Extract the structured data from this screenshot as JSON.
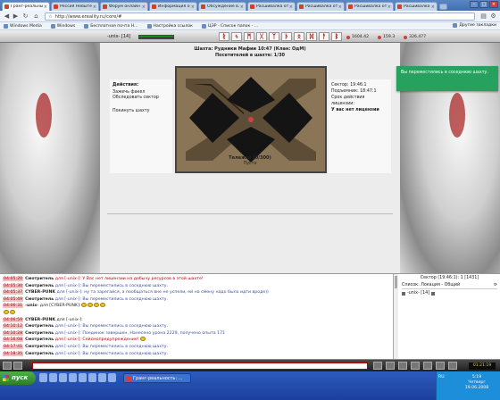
{
  "browser": {
    "tabs": [
      {
        "label": "Гранг-реальные..."
      },
      {
        "label": "Рессия Невыте..."
      },
      {
        "label": "Форум онлайн и..."
      },
      {
        "label": "Информация о..."
      },
      {
        "label": "Обсуждение в..."
      },
      {
        "label": "Расшивалка от ..."
      },
      {
        "label": "Расшивалка от ..."
      },
      {
        "label": "Расшивалка от ..."
      },
      {
        "label": "Расшивалка от ..."
      }
    ],
    "url": "http://www.ereality.ru/core/#",
    "bookmarks": [
      "Windows Media",
      "Windows",
      "Бесплатная почта H...",
      "Настройка ссылок",
      "ЦЭР - Список папок - ..."
    ],
    "other_bookmarks": "Другие закладки"
  },
  "game": {
    "user": "-unix- [14]",
    "stats": [
      "1604.42",
      "159.3",
      "326.477"
    ],
    "runes": [
      "ᚱ",
      "ᛃ",
      "ᛗ",
      "ᚷ",
      "ᛉ",
      "ᚦ",
      "ᛟ",
      "ᛞ",
      "ᚨ",
      "ᛒ",
      "ᛏ"
    ],
    "mine_title": "Шахта: Рудники Мафии 10:47 (Клан: ОдМ)",
    "mine_visitors": "Посетителей в шахте: 1/30",
    "actions_title": "Действия:",
    "actions": [
      "Зажечь факел",
      "Обследовать сектор",
      "Покинуть шахту"
    ],
    "info": {
      "sector": "Сектор: 19:46:1",
      "rise": "Подъемник: 18:47:1",
      "licence_time": "Срок действия лицензии:",
      "licence_state": "У вас нет лицензии"
    },
    "wagon_title": "Тележка (0/300)",
    "wagon_state": "Пусто",
    "notification": "Вы переместились в соседнюю шахту."
  },
  "chat": {
    "messages": [
      {
        "time": "04:05:20",
        "who": "Смотритель",
        "text": " для [-unix-]: У Вас нет лицензии на добычу ресурсов в этой шахте!",
        "color": "red",
        "smileys": 0
      },
      {
        "time": "04:05:30",
        "who": "Смотритель",
        "text": " для [-unix-]: Вы переместились в соседнюю шахту.",
        "color": "blue",
        "smileys": 0
      },
      {
        "time": "04:05:37",
        "who": "CYBER-PUNK",
        "text": " для [-unix-]: ну та зарегайся, а пообщаться вне не успели, ей на смену надо было идти вроде))",
        "color": "blue",
        "smileys": 0
      },
      {
        "time": "04:05:49",
        "who": "Смотритель",
        "text": " для [-unix-]: Вы переместились в соседнюю шахту.",
        "color": "blue",
        "smileys": 0
      },
      {
        "time": "04:06:31",
        "who": "-unix-",
        "text": " для [CYBER-PUNK]:",
        "color": "black",
        "smileys": 4
      },
      {
        "time": "",
        "who": "",
        "text": "",
        "color": "black",
        "smileys": 2
      },
      {
        "time": "04:06:59",
        "who": "CYBER-PUNK",
        "text": " для [-unix-]:",
        "color": "black",
        "smileys": 0
      },
      {
        "time": "04:10:12",
        "who": "Смотритель",
        "text": " для [-unix-]: Вы переместились в соседнюю шахту.",
        "color": "blue",
        "smileys": 0
      },
      {
        "time": "04:10:28",
        "who": "Смотритель",
        "text": " для [-unix-]: Поединок завершен. Нанесено урона 2229, получено опыта 171",
        "color": "blue",
        "smileys": 0
      },
      {
        "time": "04:16:08",
        "who": "Смотритель",
        "text": " для [-unix-]: Сейсмопредупреждение!",
        "color": "red",
        "smileys": 1
      },
      {
        "time": "04:17:41",
        "who": "Смотритель",
        "text": " для [-unix-]: Вы переместились в соседнюю шахту.",
        "color": "blue",
        "smileys": 0
      },
      {
        "time": "04:18:35",
        "who": "Смотритель",
        "text": " для [-unix-]: Вы переместились в соседнюю шахту.",
        "color": "blue",
        "smileys": 0
      }
    ]
  },
  "online": {
    "sector": "Сектор (19:46:1): 1 [1431]",
    "list_label": "Список: Локация - Общий",
    "user": "-unix- [14]"
  },
  "bottom": {
    "time": "01:21:19"
  },
  "taskbar": {
    "start": "пуск",
    "item": "Гранг-реальность: ...",
    "lang": "RU",
    "clock": "5:19\nЧетверг\n19.06.2008"
  }
}
